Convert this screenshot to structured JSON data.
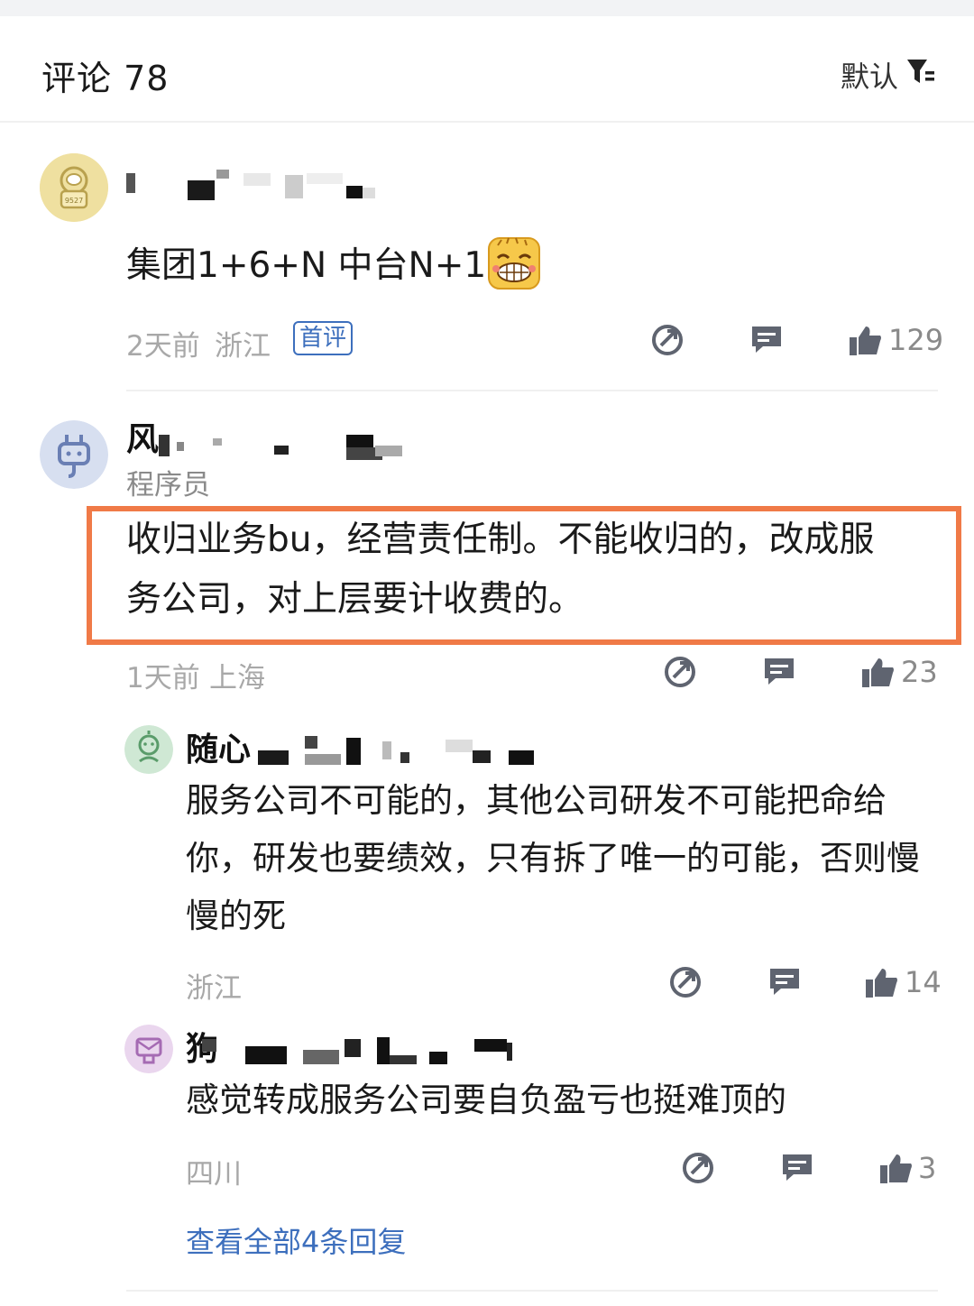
{
  "header": {
    "title": "评论 78",
    "sort_label": "默认",
    "filter_icon": "filter-icon"
  },
  "comments": [
    {
      "name_visible": "",
      "content": "集团1+6+N 中台N+1",
      "emoji": "grinning-face-emoji",
      "time": "2天前",
      "location": "浙江",
      "badge": "首评",
      "likes": "129"
    },
    {
      "name_visible": "风",
      "role": "程序员",
      "content_line1": "收归业务bu，经营责任制。不能收归的，改成服",
      "content_line2": "务公司，对上层要计收费的。",
      "time": "1天前",
      "location": "上海",
      "likes": "23",
      "highlight_color": "#f07a47"
    }
  ],
  "replies": [
    {
      "name_visible": "随心",
      "content_line1": "服务公司不可能的，其他公司研发不可能把命给",
      "content_line2": "你，研发也要绩效，只有拆了唯一的可能，否则慢",
      "content_line3": "慢的死",
      "location": "浙江",
      "likes": "14"
    },
    {
      "name_visible": "狗",
      "content_line1": "感觉转成服务公司要自负盈亏也挺难顶的",
      "location": "四川",
      "likes": "3"
    }
  ],
  "view_all_label": "查看全部4条回复",
  "colors": {
    "accent_blue": "#3d6fbd",
    "meta_gray": "#a8a8a8",
    "highlight": "#f07a47",
    "icon_gray": "#5f6470"
  }
}
